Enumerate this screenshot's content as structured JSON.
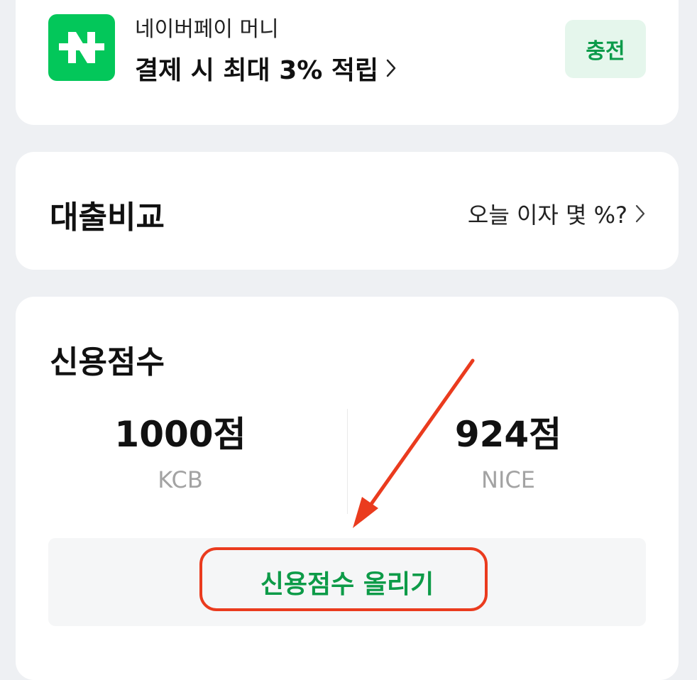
{
  "naverpay": {
    "title": "네이버페이 머니",
    "benefit": "결제 시 최대 3% 적립",
    "charge_label": "충전",
    "logo_letter": "N",
    "brand_color": "#03c75a"
  },
  "loan": {
    "title": "대출비교",
    "link_label": "오늘 이자 몇 %?"
  },
  "credit": {
    "title": "신용점수",
    "scores": [
      {
        "value": "1000점",
        "agency": "KCB"
      },
      {
        "value": "924점",
        "agency": "NICE"
      }
    ],
    "raise_label": "신용점수 올리기",
    "accent_color": "#0d9b48"
  },
  "annotation": {
    "color": "#ea3b1e"
  }
}
